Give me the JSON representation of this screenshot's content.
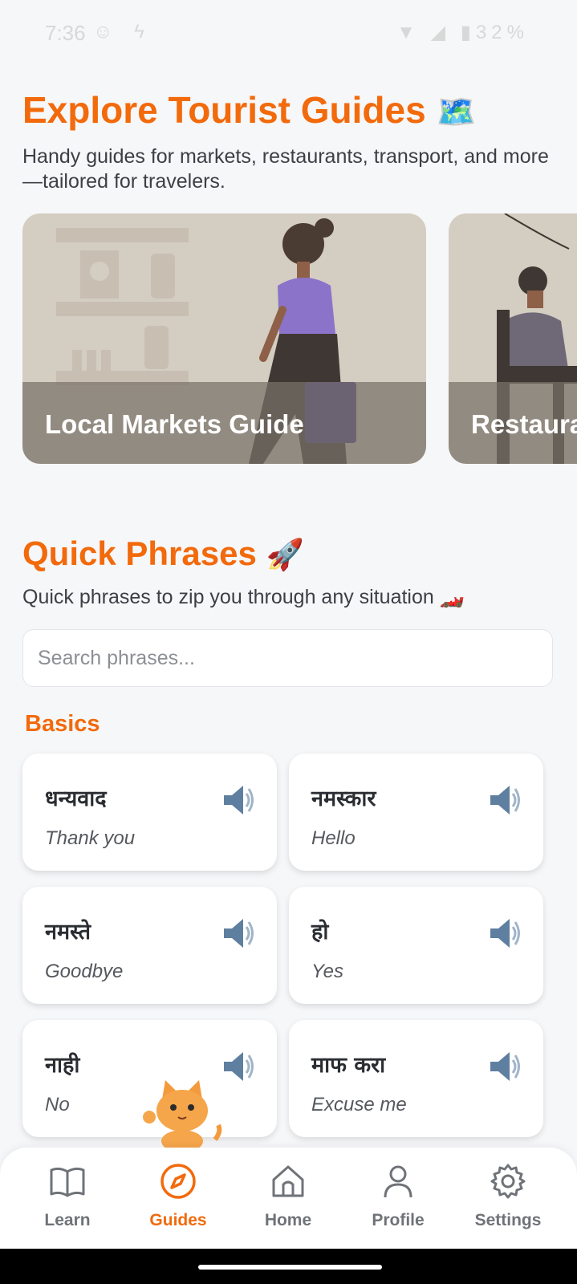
{
  "status_bar": {
    "time": "7:36",
    "battery": "32%"
  },
  "header": {
    "title": "Explore Tourist Guides",
    "title_emoji": "🗺️",
    "subtitle": "Handy guides for markets, restaurants, transport, and more—tailored for travelers."
  },
  "guides": [
    {
      "label": "Local Markets Guide"
    },
    {
      "label": "Restaura"
    }
  ],
  "quick": {
    "title": "Quick Phrases",
    "title_emoji": "🚀",
    "subtitle": "Quick phrases to zip you through any situation",
    "subtitle_emoji": "🏎️"
  },
  "search": {
    "placeholder": "Search phrases...",
    "value": ""
  },
  "basics": {
    "title": "Basics",
    "phrases": [
      {
        "native": "धन्यवाद",
        "english": "Thank you"
      },
      {
        "native": "नमस्कार",
        "english": "Hello"
      },
      {
        "native": "नमस्ते",
        "english": "Goodbye"
      },
      {
        "native": "हो",
        "english": "Yes"
      },
      {
        "native": "नाही",
        "english": "No"
      },
      {
        "native": "माफ करा",
        "english": "Excuse me"
      }
    ]
  },
  "nav": {
    "items": [
      {
        "label": "Learn",
        "icon": "book-icon"
      },
      {
        "label": "Guides",
        "icon": "compass-icon",
        "active": true
      },
      {
        "label": "Home",
        "icon": "home-icon"
      },
      {
        "label": "Profile",
        "icon": "person-icon"
      },
      {
        "label": "Settings",
        "icon": "gear-icon"
      }
    ]
  },
  "colors": {
    "accent": "#f26a0b",
    "background": "#f6f7f9",
    "inactive": "#6f7378"
  }
}
